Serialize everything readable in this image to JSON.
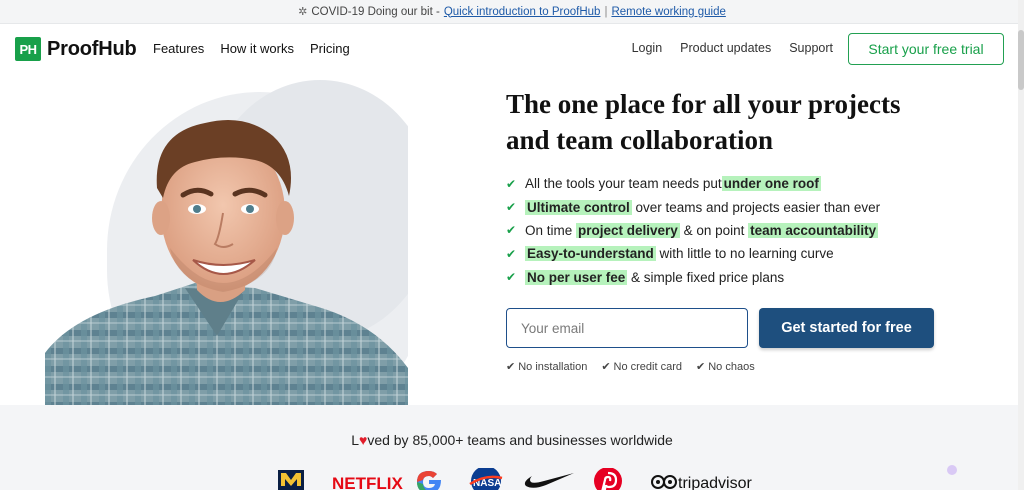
{
  "announcement": {
    "prefix": "COVID-19 Doing our bit - ",
    "link1": "Quick introduction to ProofHub",
    "separator": "|",
    "link2": "Remote working guide"
  },
  "nav": {
    "logo_mark": "PH",
    "logo_text": "ProofHub",
    "left": [
      "Features",
      "How it works",
      "Pricing"
    ],
    "right": [
      "Login",
      "Product updates",
      "Support"
    ],
    "trial_label": "Start your free trial"
  },
  "hero": {
    "headline_line1": "The one place for all your projects",
    "headline_line2": "and team collaboration",
    "features": [
      {
        "before": "All the tools your team needs put ",
        "hl": "under one roof",
        "after": ""
      },
      {
        "before": "",
        "hl": "Ultimate control",
        "after": " over teams and projects easier than ever"
      },
      {
        "before": "On time ",
        "hl": "project delivery",
        "after": " & on point ",
        "hl2": "team accountability"
      },
      {
        "before": "",
        "hl": "Easy-to-understand",
        "after": " with little to no learning curve"
      },
      {
        "before": "",
        "hl": "No per user fee",
        "after": " & simple fixed price plans"
      }
    ],
    "email_placeholder": "Your email",
    "cta_label": "Get started for free",
    "mini": [
      "No installation",
      "No credit card",
      "No chaos"
    ]
  },
  "social": {
    "loved_prefix": "L",
    "loved_heart": "♥",
    "loved_suffix": "ved by 85,000+ teams and businesses worldwide",
    "logos": [
      "michigan",
      "NETFLIX",
      "google",
      "NASA",
      "nike",
      "pinterest",
      "tripadvisor"
    ]
  },
  "colors": {
    "brand_green": "#18a04a",
    "cta_blue": "#1e4f7e",
    "highlight": "#b6f2bc",
    "heart_red": "#e11d2b"
  }
}
